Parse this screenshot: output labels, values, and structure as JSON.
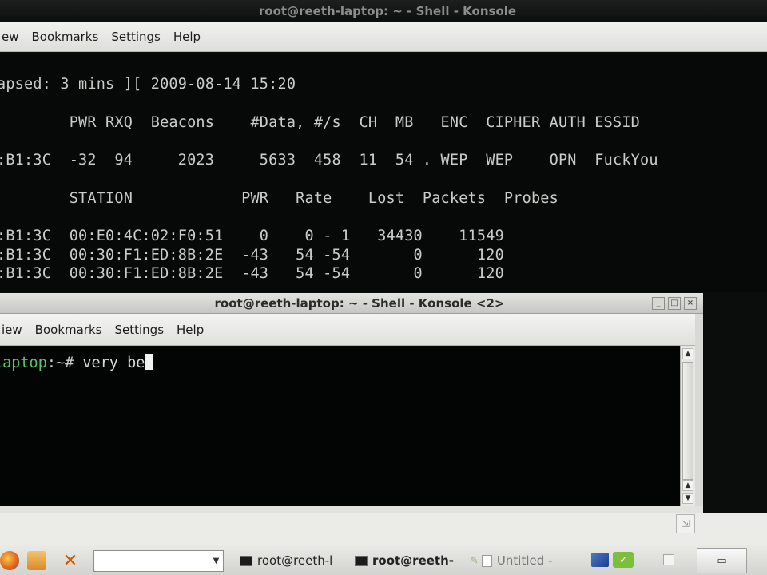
{
  "window_back": {
    "title": "root@reeth-laptop: ~ - Shell - Konsole",
    "menu": [
      "ew",
      "Bookmarks",
      "Settings",
      "Help"
    ],
    "terminal_lines": [
      "apsed: 3 mins ][ 2009-08-14 15:20",
      "        PWR RXQ  Beacons    #Data, #/s  CH  MB   ENC  CIPHER AUTH ESSID",
      ":B1:3C  -32  94     2023     5633  458  11  54 . WEP  WEP    OPN  FuckYou",
      "        STATION            PWR   Rate    Lost  Packets  Probes",
      ":B1:3C  00:E0:4C:02:F0:51    0    0 - 1   34430    11549",
      ":B1:3C  00:30:F1:ED:8B:2E  -43   54 -54       0      120",
      ":B1:3C  00:30:F1:ED:8B:2E  -43   54 -54       0      120"
    ]
  },
  "window_front": {
    "title": "root@reeth-laptop: ~ - Shell - Konsole <2>",
    "menu": [
      "iew",
      "Bookmarks",
      "Settings",
      "Help"
    ],
    "prompt_host": "laptop",
    "prompt_symbol": ":~# ",
    "typed_text": "very be",
    "window_buttons": [
      "_",
      "□",
      "×"
    ]
  },
  "taskbar": {
    "tasks": [
      {
        "label": "root@reeth-l"
      },
      {
        "label": "root@reeth-"
      },
      {
        "label": "Untitled -"
      }
    ],
    "icons": [
      "firefox-icon",
      "folder-icon",
      "tools-icon",
      "network-icon",
      "update-icon"
    ]
  },
  "colors": {
    "terminal_bg": "#070908",
    "terminal_fg": "#c9ccc8",
    "prompt_green": "#5bc466",
    "menubar_bg": "#e6e7e3"
  }
}
